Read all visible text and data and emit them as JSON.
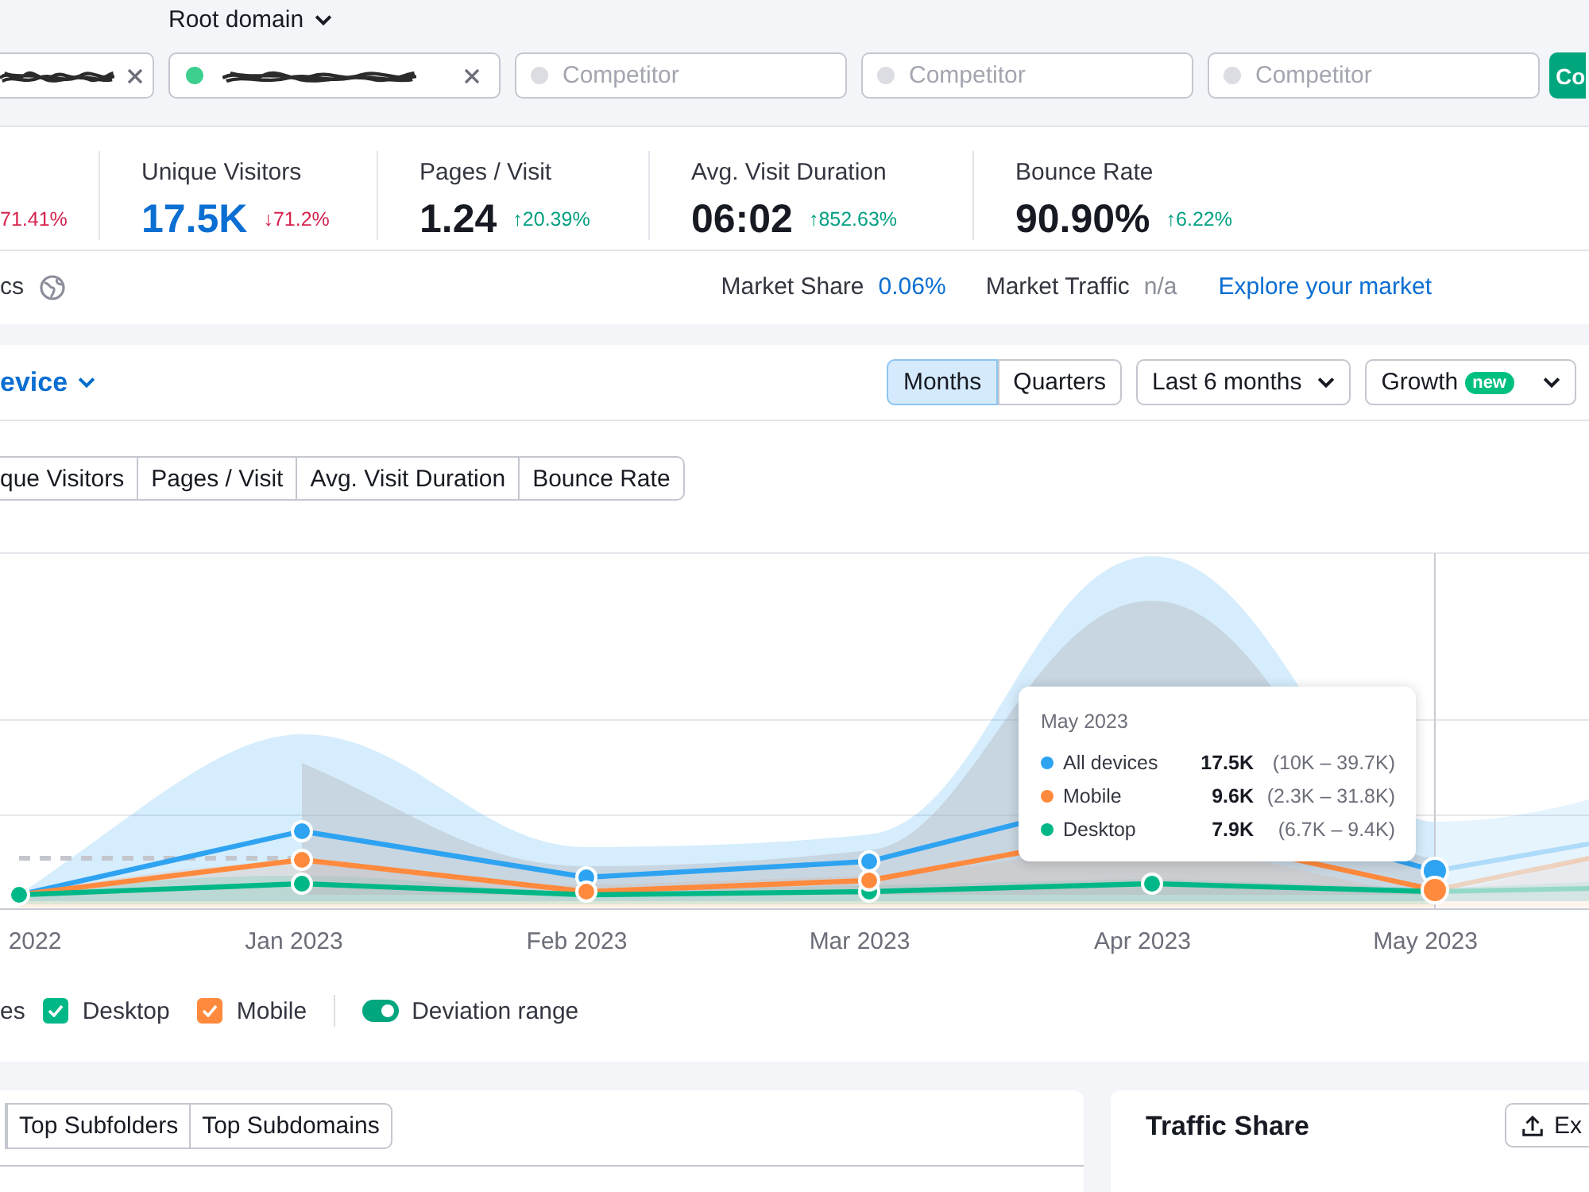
{
  "domain_bar": {
    "scope": "Root domain",
    "fields": [
      {
        "kind": "filled"
      },
      {
        "kind": "filled",
        "color": "#3ccf8e"
      },
      {
        "kind": "empty",
        "placeholder": "Competitor"
      },
      {
        "kind": "empty",
        "placeholder": "Competitor"
      },
      {
        "kind": "empty",
        "placeholder": "Competitor"
      }
    ],
    "compare_button": "Co"
  },
  "metrics": {
    "cut_change": {
      "text": "71.41%",
      "increase": false
    },
    "items": [
      {
        "label": "Unique Visitors",
        "value": "17.5K",
        "change": "↓71.2%",
        "increase": false,
        "selected": true
      },
      {
        "label": "Pages / Visit",
        "value": "1.24",
        "change": "↑20.39%",
        "increase": true,
        "selected": false
      },
      {
        "label": "Avg. Visit Duration",
        "value": "06:02",
        "change": "↑852.63%",
        "increase": true,
        "selected": false
      },
      {
        "label": "Bounce Rate",
        "value": "90.90%",
        "change": "↑6.22%",
        "increase": true,
        "selected": false
      }
    ]
  },
  "market": {
    "cut_label": "cs",
    "share_label": "Market Share",
    "share_value": "0.06%",
    "traffic_label": "Market Traffic",
    "traffic_value": "n/a",
    "link": "Explore your market"
  },
  "chart_card": {
    "title": "evice",
    "granularity": [
      {
        "label": "Months",
        "selected": true
      },
      {
        "label": "Quarters",
        "selected": false
      }
    ],
    "period": "Last 6 months",
    "mode": {
      "label": "Growth",
      "badge": "new"
    },
    "metric_tabs": [
      "que Visitors",
      "Pages / Visit",
      "Avg. Visit Duration",
      "Bounce Rate"
    ],
    "x_labels": [
      "2022",
      "Jan 2023",
      "Feb 2023",
      "Mar 2023",
      "Apr 2023",
      "May 2023"
    ],
    "tooltip": {
      "title": "May 2023",
      "rows": [
        {
          "label": "All devices",
          "value": "17.5K",
          "range": "(10K – 39.7K)",
          "color": "#2ea3f2"
        },
        {
          "label": "Mobile",
          "value": "9.6K",
          "range": "(2.3K – 31.8K)",
          "color": "#ff8a3d"
        },
        {
          "label": "Desktop",
          "value": "7.9K",
          "range": "(6.7K – 9.4K)",
          "color": "#00b887"
        }
      ]
    },
    "legend": {
      "cut_label": "es",
      "series": [
        {
          "label": "Desktop",
          "checked": true,
          "color": "#00b887"
        },
        {
          "label": "Mobile",
          "checked": true,
          "color": "#ff8a3d"
        }
      ],
      "deviation": {
        "label": "Deviation range",
        "on": true
      }
    }
  },
  "pages_card": {
    "tabs": [
      "Top Subfolders",
      "Top Subdomains"
    ]
  },
  "traffic_share": {
    "title": "Traffic Share",
    "export_button": "Ex"
  }
}
